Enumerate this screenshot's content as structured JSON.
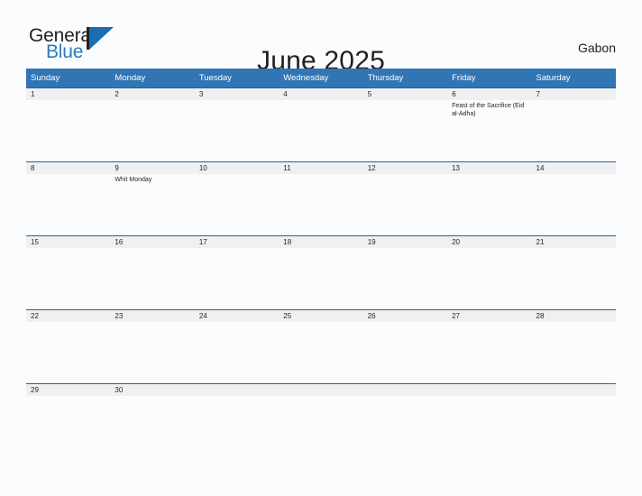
{
  "brand": {
    "name_part1": "General",
    "name_part2": "Blue",
    "mark": "blue-flag-triangle"
  },
  "header": {
    "title": "June 2025",
    "region": "Gabon"
  },
  "colors": {
    "header_blue": "#3175b5",
    "row_rule_blue": "#2a6199",
    "daynum_band": "#f0f0f0",
    "brand_blue": "#2e7ac0",
    "page_background": "#fbfcfd",
    "text": "#231f20"
  },
  "calendar": {
    "weekdays": [
      "Sunday",
      "Monday",
      "Tuesday",
      "Wednesday",
      "Thursday",
      "Friday",
      "Saturday"
    ],
    "weeks": [
      [
        {
          "day": "1",
          "events": []
        },
        {
          "day": "2",
          "events": []
        },
        {
          "day": "3",
          "events": []
        },
        {
          "day": "4",
          "events": []
        },
        {
          "day": "5",
          "events": []
        },
        {
          "day": "6",
          "events": [
            "Feast of the Sacrifice (Eid al-Adha)"
          ]
        },
        {
          "day": "7",
          "events": []
        }
      ],
      [
        {
          "day": "8",
          "events": []
        },
        {
          "day": "9",
          "events": [
            "Whit Monday"
          ]
        },
        {
          "day": "10",
          "events": []
        },
        {
          "day": "11",
          "events": []
        },
        {
          "day": "12",
          "events": []
        },
        {
          "day": "13",
          "events": []
        },
        {
          "day": "14",
          "events": []
        }
      ],
      [
        {
          "day": "15",
          "events": []
        },
        {
          "day": "16",
          "events": []
        },
        {
          "day": "17",
          "events": []
        },
        {
          "day": "18",
          "events": []
        },
        {
          "day": "19",
          "events": []
        },
        {
          "day": "20",
          "events": []
        },
        {
          "day": "21",
          "events": []
        }
      ],
      [
        {
          "day": "22",
          "events": []
        },
        {
          "day": "23",
          "events": []
        },
        {
          "day": "24",
          "events": []
        },
        {
          "day": "25",
          "events": []
        },
        {
          "day": "26",
          "events": []
        },
        {
          "day": "27",
          "events": []
        },
        {
          "day": "28",
          "events": []
        }
      ],
      [
        {
          "day": "29",
          "events": []
        },
        {
          "day": "30",
          "events": []
        },
        {
          "day": "",
          "events": []
        },
        {
          "day": "",
          "events": []
        },
        {
          "day": "",
          "events": []
        },
        {
          "day": "",
          "events": []
        },
        {
          "day": "",
          "events": []
        }
      ]
    ]
  }
}
